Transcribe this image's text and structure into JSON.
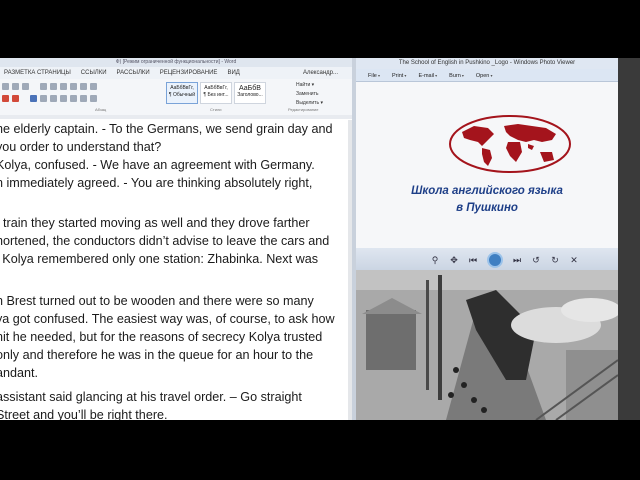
{
  "word": {
    "title": "Ф) [Режим ограниченной функциональности] - Word",
    "tabs": [
      "РАЗМЕТКА СТРАНИЦЫ",
      "ССЫЛКИ",
      "РАССЫЛКИ",
      "РЕЦЕНЗИРОВАНИЕ",
      "ВИД"
    ],
    "account": "Александр...",
    "styles": [
      {
        "sample": "АаБбВвГг,",
        "name": "¶ Обычный"
      },
      {
        "sample": "АаБбВвГг,",
        "name": "¶ Без инт..."
      },
      {
        "sample": "АаБбВ",
        "name": "Заголово..."
      }
    ],
    "editing": [
      "Найти ▾",
      "Заменить",
      "Выделить ▾"
    ],
    "groups": {
      "paragraph": "Абзац",
      "styles": "Стили",
      "editing": "Редактирование"
    },
    "lines": [
      "he elderly captain. - To the Germans, we send grain day and",
      "you order to understand that?",
      "Kolya, confused. - We have an agreement with Germany.",
      "n immediately agreed. - You are thinking absolutely right,",
      ".",
      "",
      "t train they started moving as well and they drove farther",
      "hortened, the conductors didn’t advise to leave the cars and",
      "l Kolya remembered only one station: Zhabinka. Next was",
      "",
      "",
      "n Brest turned out to be wooden and there were so many",
      "ya got confused. The easiest way was, of course, to ask how",
      "nit he needed, but for the reasons of secrecy Kolya trusted",
      "only and therefore he was in the queue for an hour to the",
      "andant.",
      "",
      " assistant said glancing at his travel order. – Go straight",
      "Street and you’ll be right there."
    ]
  },
  "viewer": {
    "title": "The School of English in Pushkino _Logo - Windows Photo Viewer",
    "menu": [
      "File",
      "Print",
      "E-mail",
      "Burn",
      "Open"
    ],
    "logo_line1": "Школа английского языка",
    "logo_line2": "в Пушкино"
  },
  "colors": {
    "logo_blue": "#1e3f88",
    "map_red": "#a4141c"
  }
}
